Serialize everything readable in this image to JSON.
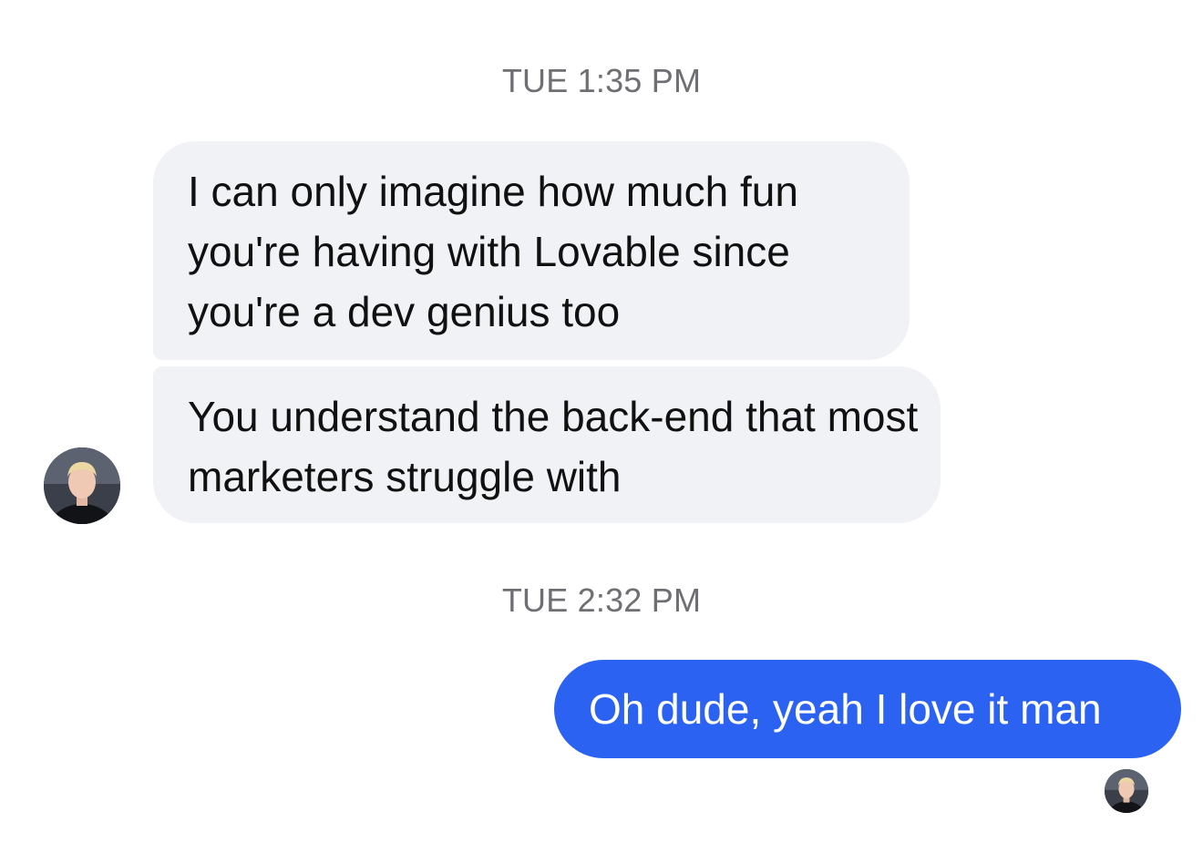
{
  "conversation": {
    "groups": [
      {
        "timestamp": "TUE 1:35 PM",
        "messages": [
          {
            "sender": "contact",
            "text": "I can only imagine how much fun you're having with Lovable since you're a dev genius too"
          },
          {
            "sender": "contact",
            "text": "You understand the back-end that most marketers struggle with"
          }
        ]
      },
      {
        "timestamp": "TUE 2:32 PM",
        "messages": [
          {
            "sender": "me",
            "text": "Oh dude, yeah I love it man"
          }
        ]
      }
    ],
    "contact_avatar_icon": "user-avatar-icon",
    "read_receipt_icon": "read-receipt-avatar-icon"
  },
  "colors": {
    "incoming_bubble": "#f1f2f6",
    "outgoing_bubble": "#2b62f2",
    "timestamp_text": "#6e6e73"
  }
}
